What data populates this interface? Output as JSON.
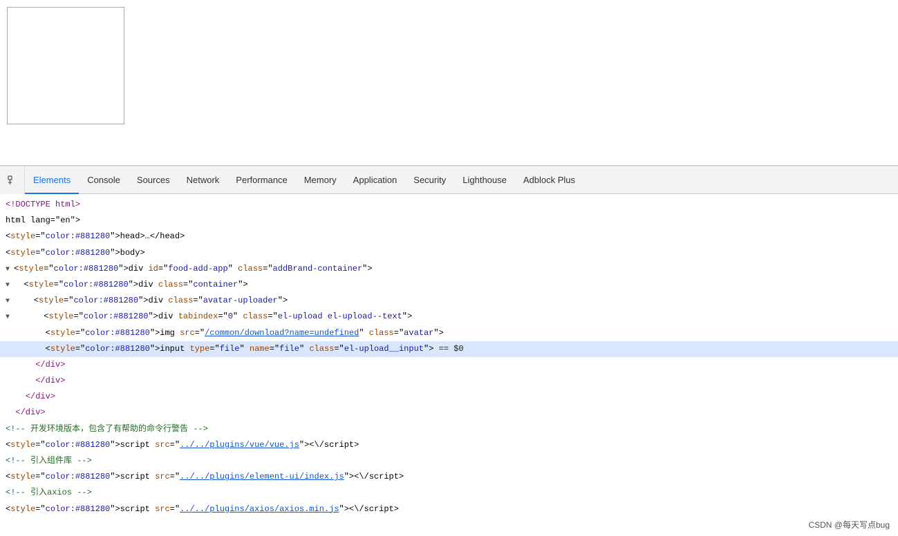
{
  "webpage": {
    "image_alt": "webpage preview image"
  },
  "devtools": {
    "tabs": [
      {
        "id": "elements",
        "label": "Elements",
        "active": true
      },
      {
        "id": "console",
        "label": "Console",
        "active": false
      },
      {
        "id": "sources",
        "label": "Sources",
        "active": false
      },
      {
        "id": "network",
        "label": "Network",
        "active": false
      },
      {
        "id": "performance",
        "label": "Performance",
        "active": false
      },
      {
        "id": "memory",
        "label": "Memory",
        "active": false
      },
      {
        "id": "application",
        "label": "Application",
        "active": false
      },
      {
        "id": "security",
        "label": "Security",
        "active": false
      },
      {
        "id": "lighthouse",
        "label": "Lighthouse",
        "active": false
      },
      {
        "id": "adblock",
        "label": "Adblock Plus",
        "active": false
      }
    ]
  },
  "html_lines": [
    {
      "id": 1,
      "indent": 0,
      "raw": "DOCTYPE html>"
    },
    {
      "id": 2,
      "indent": 0,
      "raw": "html lang=\"en\">"
    },
    {
      "id": 3,
      "indent": 0,
      "raw": "<head>…</head>"
    },
    {
      "id": 4,
      "indent": 0,
      "raw": "<body>"
    },
    {
      "id": 5,
      "indent": 0,
      "triangle": "▼",
      "raw": "<div id=\"food-add-app\" class=\"addBrand-container\">"
    },
    {
      "id": 6,
      "indent": 1,
      "triangle": "▼",
      "raw": "<div class=\"container\">"
    },
    {
      "id": 7,
      "indent": 2,
      "triangle": "▼",
      "raw": "<div class=\"avatar-uploader\">"
    },
    {
      "id": 8,
      "indent": 3,
      "triangle": "▼",
      "raw": "<div tabindex=\"0\" class=\"el-upload el-upload--text\">"
    },
    {
      "id": 9,
      "indent": 4,
      "raw": "<img src=\"/common/download?name=undefined\" class=\"avatar\">"
    },
    {
      "id": 10,
      "indent": 4,
      "highlighted": true,
      "raw": "<input type=\"file\" name=\"file\" class=\"el-upload__input\"> == $0"
    },
    {
      "id": 11,
      "indent": 3,
      "raw": "</div>"
    },
    {
      "id": 12,
      "indent": 3,
      "raw": "</div>"
    },
    {
      "id": 13,
      "indent": 2,
      "raw": "</div>"
    },
    {
      "id": 14,
      "indent": 1,
      "raw": "</div>"
    },
    {
      "id": 15,
      "indent": 0,
      "raw": "<!-- 开发环境版本，包含了有帮助的命令行警告 -->"
    },
    {
      "id": 16,
      "indent": 0,
      "raw": "<script src=\"../../plugins/vue/vue.js\"><\\/script>"
    },
    {
      "id": 17,
      "indent": 0,
      "raw": "<!-- 引入组件库 -->"
    },
    {
      "id": 18,
      "indent": 0,
      "raw": "<script src=\"../../plugins/element-ui/index.js\"><\\/script>"
    },
    {
      "id": 19,
      "indent": 0,
      "raw": "<!-- 引入axios -->"
    },
    {
      "id": 20,
      "indent": 0,
      "raw": "<script src=\"../../plugins/axios/axios.min.js\"><\\/script>"
    }
  ],
  "watermark": {
    "text": "CSDN @每天写点bug"
  }
}
